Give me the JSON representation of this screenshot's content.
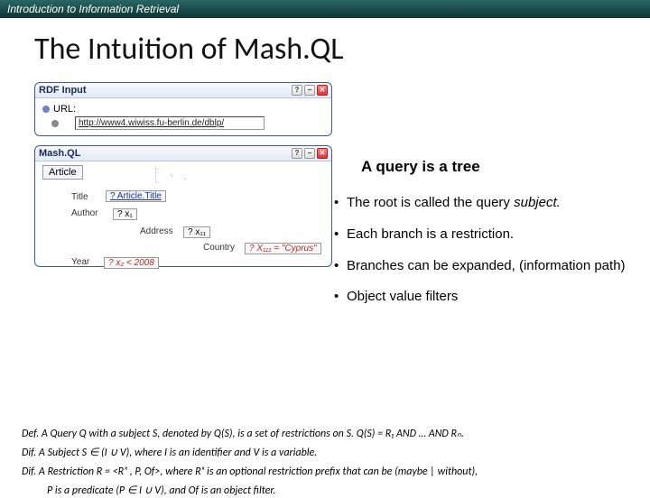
{
  "header": {
    "course": "Introduction to Information Retrieval"
  },
  "title": "The Intuition of Mash.QL",
  "rdf_panel": {
    "title": "RDF Input",
    "url_label": "URL:",
    "url_value": "http://www4.wiwiss.fu-berlin.de/dblp/"
  },
  "tagline": "A query is a tree",
  "mashql_panel": {
    "title": "Mash.QL",
    "root": "Article",
    "b_title": "Title",
    "v_title": "? Article.Title",
    "b_author": "Author",
    "v_author": "? x₁",
    "b_address": "Address",
    "v_address": "? x₁₁",
    "b_country": "Country",
    "v_country": "? X₁₁₁ = \"Cyprus\"",
    "b_year": "Year",
    "v_year": "? x₂ < 2008"
  },
  "bullets": {
    "b1a": "The root is called the query ",
    "b1b": "subject.",
    "b2": "Each branch is a restriction.",
    "b3": "Branches can be expanded, (information path)",
    "b4": "Object value filters"
  },
  "defs": {
    "d1": "Def. A Query Q with a subject S, denoted by Q(S), is a set of restrictions on S. Q(S) = R₁ AND … AND Rₙ.",
    "d2": "Dif. A Subject S ∈ (I ∪ V), where I is an identifier and V is a variable.",
    "d3a": "Dif. A Restriction R = <Rₓ , P, Of>, where Rₓ is an optional restriction prefix that can be (maybe | without),",
    "d3b": "P is a predicate (P ∈ I ∪ V), and Of is an object filter."
  }
}
